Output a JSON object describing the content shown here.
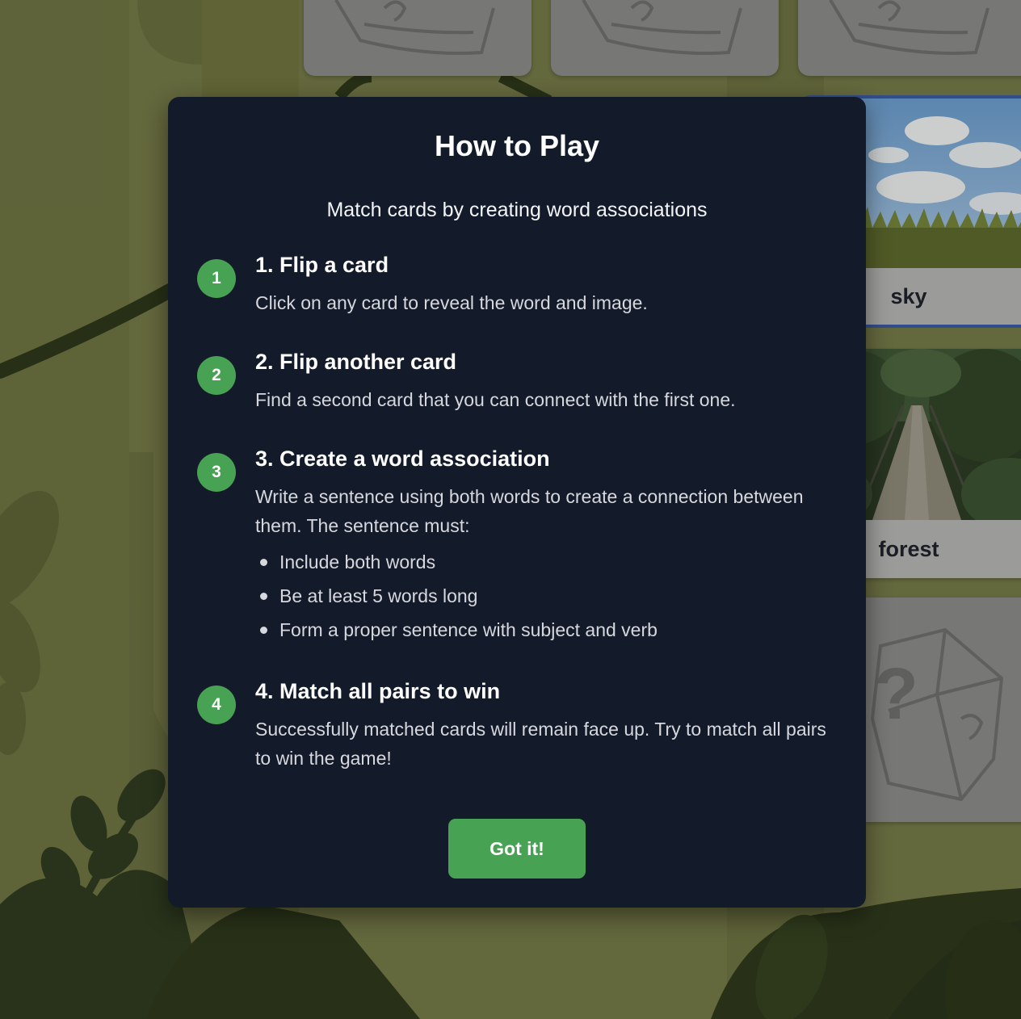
{
  "background": {
    "theme": "jungle",
    "base_color": "#7a7f4c",
    "leaf_color": "#2e3a1f"
  },
  "cards": [
    {
      "state": "face-down",
      "icon": "mystery-card-icon"
    },
    {
      "state": "face-down",
      "icon": "mystery-card-icon"
    },
    {
      "state": "face-down",
      "icon": "mystery-card-icon"
    },
    {
      "state": "face-up",
      "word": "sky",
      "image": "sky-over-grass-photo",
      "selected": true
    },
    {
      "state": "face-up",
      "word": "forest",
      "image": "forest-boardwalk-photo",
      "selected": false
    },
    {
      "state": "face-down",
      "icon": "mystery-card-icon"
    }
  ],
  "modal": {
    "title": "How to Play",
    "subtitle": "Match cards by creating word associations",
    "steps": [
      {
        "number": "1",
        "title": "1. Flip a card",
        "description": "Click on any card to reveal the word and image."
      },
      {
        "number": "2",
        "title": "2. Flip another card",
        "description": "Find a second card that you can connect with the first one."
      },
      {
        "number": "3",
        "title": "3. Create a word association",
        "description": "Write a sentence using both words to create a connection between them. The sentence must:",
        "rules": [
          "Include both words",
          "Be at least 5 words long",
          "Form a proper sentence with subject and verb"
        ]
      },
      {
        "number": "4",
        "title": "4. Match all pairs to win",
        "description": "Successfully matched cards will remain face up. Try to match all pairs to win the game!"
      }
    ],
    "button_label": "Got it!",
    "accent_color": "#48a253",
    "panel_color": "#131a29"
  }
}
